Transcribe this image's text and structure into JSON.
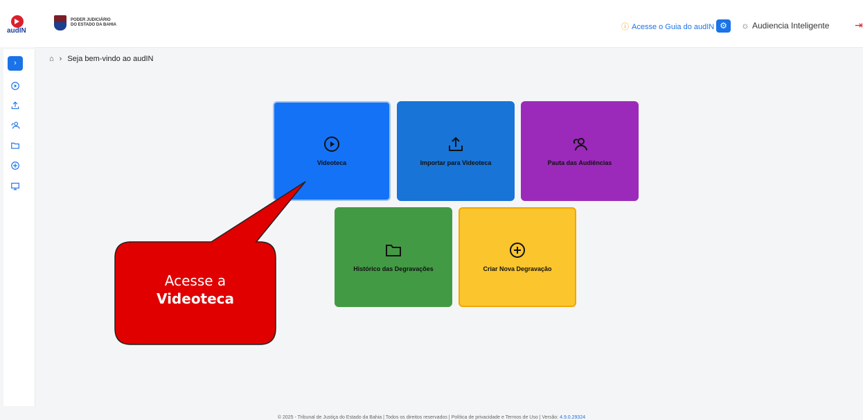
{
  "header": {
    "logo_text": "audIN",
    "institution_line1": "PODER JUDICIÁRIO",
    "institution_line2": "DO ESTADO DA BAHIA",
    "guide_link": "Acesse o Guia do audIN",
    "app_name": "Audiencia Inteligente"
  },
  "sidebar": {
    "expand_icon": "chevron-right-icon",
    "items": [
      {
        "icon": "play-circle-icon"
      },
      {
        "icon": "upload-icon"
      },
      {
        "icon": "users-icon"
      },
      {
        "icon": "folder-icon"
      },
      {
        "icon": "plus-circle-icon"
      },
      {
        "icon": "monitor-icon"
      }
    ]
  },
  "breadcrumb": {
    "current": "Seja bem-vindo ao audIN"
  },
  "tiles": [
    {
      "label": "Videoteca",
      "icon": "play-circle-icon",
      "color": "#1472f7"
    },
    {
      "label": "Importar para Videoteca",
      "icon": "upload-icon",
      "color": "#1874d6"
    },
    {
      "label": "Pauta das Audiências",
      "icon": "users-icon",
      "color": "#9b2aba"
    },
    {
      "label": "Histórico das Degravações",
      "icon": "folder-icon",
      "color": "#439a45"
    },
    {
      "label": "Criar Nova Degravação",
      "icon": "plus-circle-icon",
      "color": "#fbc52d"
    }
  ],
  "callout": {
    "line1": "Acesse a",
    "line2": "Videoteca",
    "color": "#e00000"
  },
  "footer": {
    "text": "© 2025 - Tribunal de Justiça do Estado da Bahia | Todos os direitos reservados | Política de privacidade e Termos de Uso | Versão: ",
    "version": "4.9.0.29324"
  }
}
